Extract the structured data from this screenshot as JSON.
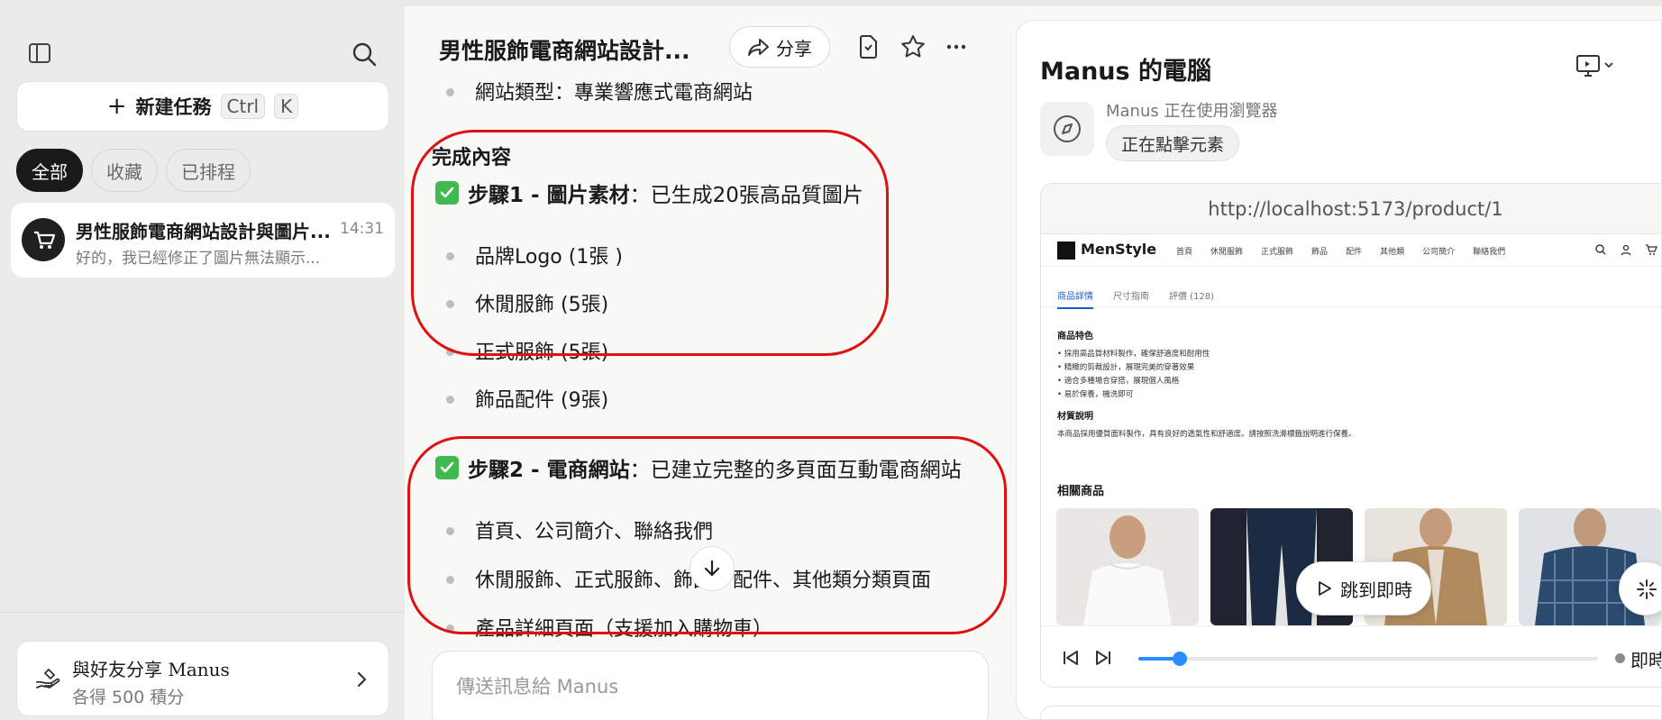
{
  "sidebar": {
    "new_task_label": "新建任務",
    "shortcut_ctrl": "Ctrl",
    "shortcut_key": "K",
    "filters": [
      "全部",
      "收藏",
      "已排程"
    ],
    "task": {
      "title": "男性服飾電商網站設計與圖片...",
      "time": "14:31",
      "preview": "好的，我已經修正了圖片無法顯示..."
    },
    "share": {
      "title": "與好友分享 Manus",
      "subtitle": "各得 500 積分"
    }
  },
  "chat": {
    "title": "男性服飾電商網站設計...",
    "share_label": "分享",
    "site_type_line": "網站類型：專業響應式電商網站",
    "section_title": "完成內容",
    "step1": {
      "title": "步驟1 - 圖片素材",
      "desc": "：已生成20張高品質圖片",
      "items": [
        "品牌Logo (1張 )",
        "休閒服飾 (5張)",
        "正式服飾 (5張)",
        "飾品配件 (9張)"
      ]
    },
    "step2": {
      "title": "步驟2 - 電商網站",
      "desc": "：已建立完整的多頁面互動電商網站",
      "items": [
        "首頁、公司簡介、聯絡我們",
        "休閒服飾、正式服飾、飾品、配件、其他類分類頁面",
        "產品詳細頁面（支援加入購物車）"
      ]
    },
    "composer_placeholder": "傳送訊息給 Manus"
  },
  "computer": {
    "title": "Manus 的電腦",
    "using_text": "Manus 正在使用瀏覽器",
    "status_chip": "正在點擊元素",
    "url": "http://localhost:5173/product/1",
    "site": {
      "brand": "MenStyle",
      "nav": [
        "首頁",
        "休閒服飾",
        "正式服飾",
        "飾品",
        "配件",
        "其他類",
        "公司簡介",
        "聯絡我們"
      ],
      "tabs": [
        "商品詳情",
        "尺寸指南",
        "評價 (128)"
      ],
      "features_title": "商品特色",
      "features": [
        "• 採用高品質材料製作，確保舒適度和耐用性",
        "• 精緻的剪裁設計，展現完美的穿著效果",
        "• 適合多種場合穿搭，展現個人風格",
        "• 易於保養，機洗即可"
      ],
      "material_title": "材質說明",
      "material_text": "本商品採用優質面料製作，具有良好的透氣性和舒適度。請按照洗滌標籤說明進行保養。",
      "related_title": "相關商品"
    },
    "jump_label": "跳到即時",
    "live_label": "即時",
    "progress": 0.09
  }
}
